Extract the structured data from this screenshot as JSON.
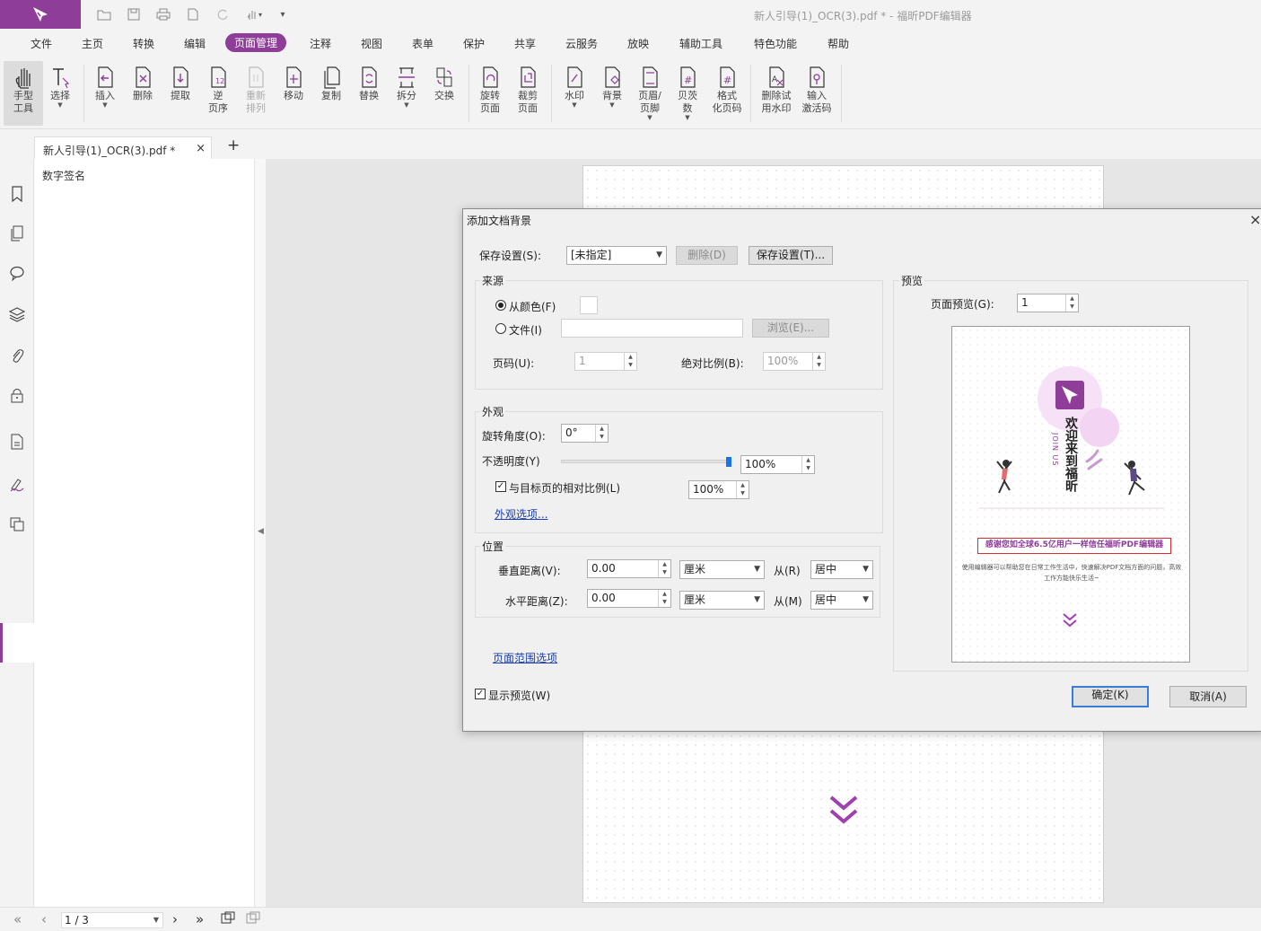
{
  "window": {
    "title": "新人引导(1)_OCR(3).pdf * - 福昕PDF编辑器",
    "brand_color": "#8e3d98"
  },
  "menu": [
    "文件",
    "主页",
    "转换",
    "编辑",
    "页面管理",
    "注释",
    "视图",
    "表单",
    "保护",
    "共享",
    "云服务",
    "放映",
    "辅助工具",
    "特色功能",
    "帮助"
  ],
  "ribbon": {
    "hand": "手型\n工具",
    "select": "选择",
    "insert": "插入",
    "delete": "删除",
    "extract": "提取",
    "reverse": "逆\n页序",
    "reorder": "重新\n排列",
    "move": "移动",
    "copy": "复制",
    "replace": "替换",
    "split": "拆分",
    "swap": "交换",
    "rotate": "旋转\n页面",
    "crop": "裁剪\n页面",
    "watermark": "水印",
    "background": "背景",
    "header_footer": "页眉/\n页脚",
    "bates": "贝茨\n数",
    "format_page_code": "格式\n化页码",
    "remove_trial_watermark": "删除试\n用水印",
    "enter_activation": "输入\n激活码"
  },
  "tab": {
    "label": "新人引导(1)_OCR(3).pdf *",
    "close": "×",
    "add": "+"
  },
  "panel": {
    "title": "数字签名"
  },
  "status": {
    "page": "1 / 3"
  },
  "dialog": {
    "title": "添加文档背景",
    "close": "×",
    "save_settings_label": "保存设置(S):",
    "save_settings_value": "[未指定]",
    "delete_btn": "删除(D)",
    "save_btn": "保存设置(T)...",
    "source": {
      "title": "来源",
      "from_color": "从颜色(F)",
      "file": "文件(I)",
      "browse": "浏览(E)...",
      "page_label": "页码(U):",
      "page_value": "1",
      "abs_scale_label": "绝对比例(B):",
      "abs_scale_value": "100%"
    },
    "appearance": {
      "title": "外观",
      "rotation_label": "旋转角度(O):",
      "rotation_value": "0°",
      "opacity_label": "不透明度(Y)",
      "opacity_value": "100%",
      "opacity": 1.0,
      "relative_label": "与目标页的相对比例(L)",
      "relative_value": "100%",
      "options_link": "外观选项..."
    },
    "position": {
      "title": "位置",
      "vertical_label": "垂直距离(V):",
      "vertical_value": "0.00",
      "vertical_unit": "厘米",
      "from_r": "从(R)",
      "vertical_from": "居中",
      "horizontal_label": "水平距离(Z):",
      "horizontal_value": "0.00",
      "horizontal_unit": "厘米",
      "from_m": "从(M)",
      "horizontal_from": "居中"
    },
    "page_range_link": "页面范围选项",
    "show_preview": "显示预览(W)",
    "preview": {
      "title": "预览",
      "page_label": "页面预览(G):",
      "page_value": "1",
      "welcome_text": "欢迎来到福昕",
      "join_us": "JOIN US",
      "banner": "感谢您如全球6.5亿用户一样信任福昕PDF编辑器",
      "description": "使用编辑器可以帮助您在日常工作生活中，快速解决PDF文档方面的问题，高效工作方能快乐生活~"
    },
    "ok_btn": "确定(K)",
    "cancel_btn": "取消(A)"
  }
}
